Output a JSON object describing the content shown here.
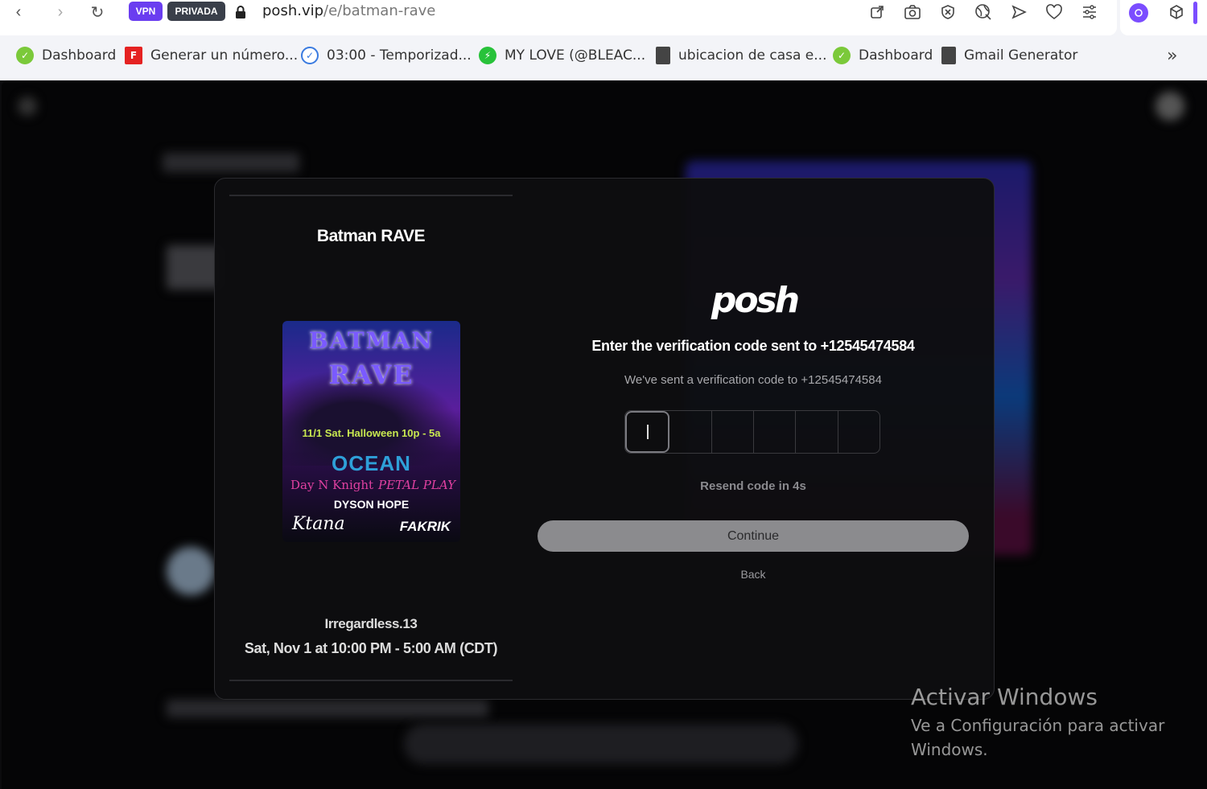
{
  "browser": {
    "vpn_label": "VPN",
    "private_label": "PRIVADA",
    "url_host": "posh.vip",
    "url_path": "/e/batman-rave",
    "bookmarks": [
      {
        "label": "Dashboard",
        "icon": "green-check-icon"
      },
      {
        "label": "Generar un número...",
        "icon": "red-f-icon"
      },
      {
        "label": "03:00 - Temporizad...",
        "icon": "timer-check-icon"
      },
      {
        "label": "MY LOVE (@BLEAC...",
        "icon": "green-bolt-icon"
      },
      {
        "label": "ubicacion de casa e...",
        "icon": "document-icon"
      },
      {
        "label": "Dashboard",
        "icon": "green-check-icon"
      },
      {
        "label": "Gmail Generator",
        "icon": "document-icon"
      }
    ],
    "more_bookmarks": "»"
  },
  "event": {
    "title": "Batman RAVE",
    "host": "Irregardless.13",
    "date": "Sat, Nov 1 at 10:00 PM - 5:00 AM (CDT)",
    "poster": {
      "line1": "BATMAN",
      "line2": "RAVE",
      "line3": "11/1 Sat. Halloween 10p - 5a",
      "line4": "OCEAN",
      "line5": "Day N Knight",
      "line6": "PETAL PLAY",
      "line7": "DYSON HOPE",
      "line8": "Ktana",
      "line9": "FAKRIK"
    }
  },
  "verify": {
    "logo": "posh",
    "heading": "Enter the verification code sent to +12545474584",
    "subtext": "We've sent a verification code to +12545474584",
    "resend": "Resend code in 4s",
    "continue_label": "Continue",
    "back_label": "Back"
  },
  "watermark": {
    "title": "Activar Windows",
    "body": "Ve a Configuración para activar Windows."
  },
  "colors": {
    "vpn": "#6a3df0",
    "private": "#3a3f4a",
    "accent_purple": "#7b4dff"
  }
}
